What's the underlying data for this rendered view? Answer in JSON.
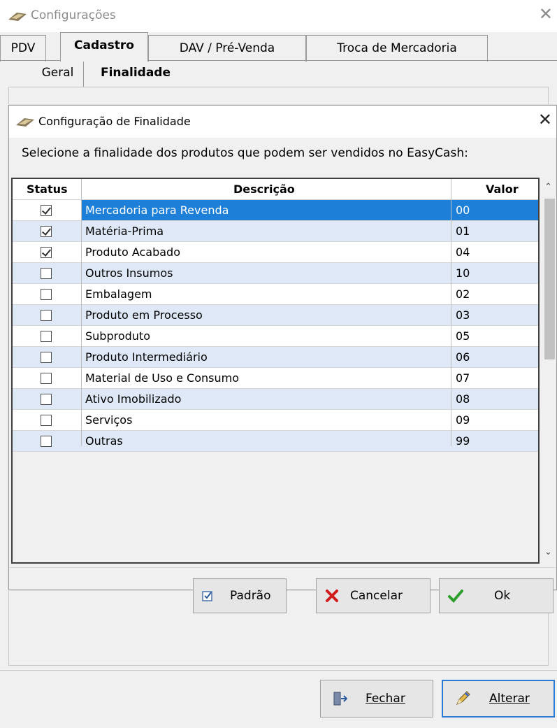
{
  "window": {
    "title": "Configurações",
    "close_glyph": "✕"
  },
  "tabs": [
    {
      "label": "PDV",
      "active": false
    },
    {
      "label": "Cadastro",
      "active": true
    },
    {
      "label": "DAV / Pré-Venda",
      "active": false
    },
    {
      "label": "Troca de Mercadoria",
      "active": false
    }
  ],
  "subtabs": [
    {
      "label": "Geral",
      "active": false
    },
    {
      "label": "Finalidade",
      "active": true
    }
  ],
  "dialog": {
    "title": "Configuração de Finalidade",
    "close_glyph": "✕",
    "instruction": "Selecione a finalidade dos produtos que podem ser vendidos no EasyCash:",
    "columns": {
      "status": "Status",
      "descricao": "Descrição",
      "valor": "Valor"
    },
    "rows": [
      {
        "checked": true,
        "descricao": "Mercadoria para Revenda",
        "valor": "00",
        "selected": true
      },
      {
        "checked": true,
        "descricao": "Matéria-Prima",
        "valor": "01"
      },
      {
        "checked": true,
        "descricao": "Produto Acabado",
        "valor": "04"
      },
      {
        "checked": false,
        "descricao": "Outros Insumos",
        "valor": "10"
      },
      {
        "checked": false,
        "descricao": "Embalagem",
        "valor": "02"
      },
      {
        "checked": false,
        "descricao": "Produto em Processo",
        "valor": "03"
      },
      {
        "checked": false,
        "descricao": "Subproduto",
        "valor": "05"
      },
      {
        "checked": false,
        "descricao": "Produto Intermediário",
        "valor": "06"
      },
      {
        "checked": false,
        "descricao": "Material de Uso e Consumo",
        "valor": "07"
      },
      {
        "checked": false,
        "descricao": "Ativo Imobilizado",
        "valor": "08"
      },
      {
        "checked": false,
        "descricao": "Serviços",
        "valor": "09"
      },
      {
        "checked": false,
        "descricao": "Outras",
        "valor": "99"
      }
    ],
    "buttons": {
      "padrao": "Padrão",
      "cancelar": "Cancelar",
      "ok": "Ok"
    }
  },
  "footer": {
    "fechar": "Fechar",
    "alterar": "Alterar"
  },
  "colors": {
    "selection": "#1e7fd8",
    "stripe": "#dfe8f7",
    "white": "#ffffff",
    "cancel_red": "#d11a1a",
    "ok_green": "#2b9e2b"
  },
  "icons": [
    "app-icon",
    "close-icon",
    "checkbox-icon",
    "cancel-icon",
    "check-icon",
    "door-exit-icon",
    "pencil-icon",
    "scroll-up-icon",
    "scroll-down-icon"
  ]
}
